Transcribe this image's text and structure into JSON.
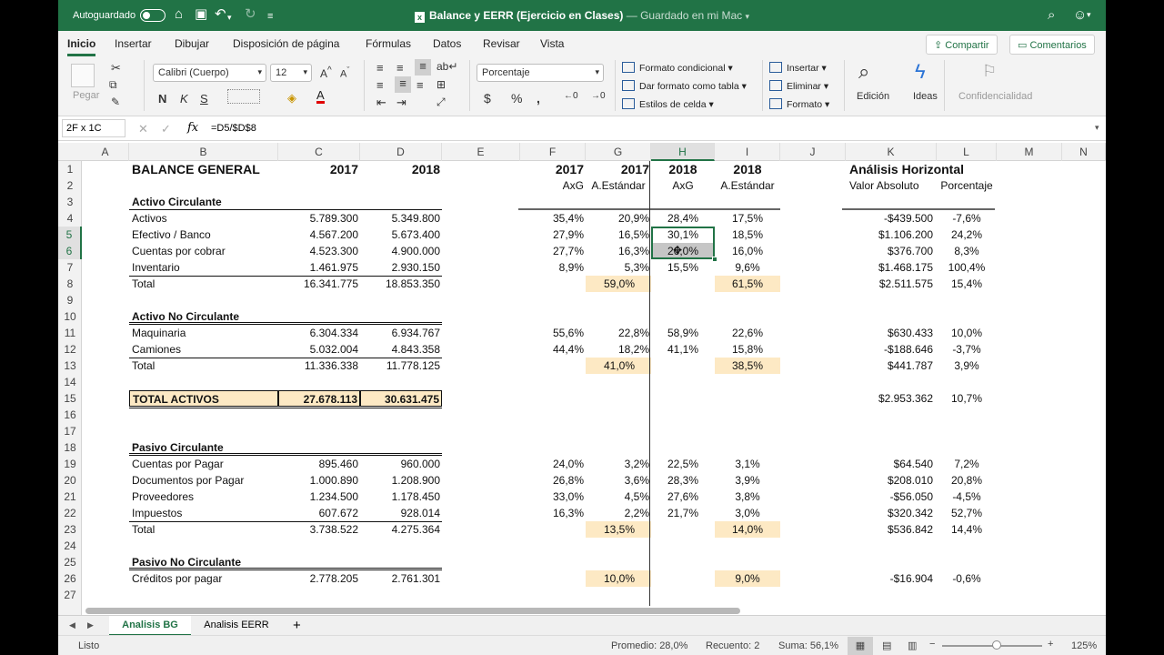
{
  "titlebar": {
    "autosave_label": "Autoguardado",
    "title": "Balance y EERR (Ejercicio en Clases)",
    "subtitle": "— Guardado en mi Mac"
  },
  "ribbon_tabs": [
    "Inicio",
    "Insertar",
    "Dibujar",
    "Disposición de página",
    "Fórmulas",
    "Datos",
    "Revisar",
    "Vista"
  ],
  "share_label": "Compartir",
  "comments_label": "Comentarios",
  "ribbon": {
    "paste_label": "Pegar",
    "font_name": "Calibri (Cuerpo)",
    "font_size": "12",
    "number_format": "Porcentaje",
    "conditional_format": "Formato condicional",
    "format_as_table": "Dar formato como tabla",
    "cell_styles": "Estilos de celda",
    "insert": "Insertar",
    "delete": "Eliminar",
    "format": "Formato",
    "edit": "Edición",
    "ideas": "Ideas",
    "confidentiality": "Confidencialidad"
  },
  "formula_bar": {
    "name_box": "2F x 1C",
    "formula": "=D5/$D$8"
  },
  "columns": [
    "A",
    "B",
    "C",
    "D",
    "E",
    "F",
    "G",
    "H",
    "I",
    "J",
    "K",
    "L",
    "M",
    "N"
  ],
  "rows": [
    "1",
    "2",
    "3",
    "4",
    "5",
    "6",
    "7",
    "8",
    "9",
    "10",
    "11",
    "12",
    "13",
    "14",
    "15",
    "16",
    "17",
    "18",
    "19",
    "20",
    "21",
    "22",
    "23",
    "24",
    "25",
    "26",
    "27"
  ],
  "header": {
    "title": "BALANCE GENERAL",
    "y2017": "2017",
    "y2018": "2018",
    "f1": "2017",
    "g1": "2017",
    "h1": "2018",
    "i1": "2018",
    "f2": "AxG",
    "g2": "A.Estándar",
    "h2": "AxG",
    "i2": "A.Estándar",
    "k1": "Análisis Horizontal",
    "k2": "Valor Absoluto",
    "l2": "Porcentaje"
  },
  "sections": {
    "activo_circulante": "Activo Circulante",
    "activo_no_circulante": "Activo No Circulante",
    "pasivo_circulante": "Pasivo Circulante",
    "pasivo_no_circulante": "Pasivo No Circulante"
  },
  "table_rows": [
    {
      "row": 4,
      "label": "Activos",
      "c": "5.789.300",
      "d": "5.349.800",
      "f": "35,4%",
      "g": "20,9%",
      "h": "28,4%",
      "i": "17,5%",
      "k": "-$439.500",
      "l": "-7,6%"
    },
    {
      "row": 5,
      "label": "Efectivo / Banco",
      "c": "4.567.200",
      "d": "5.673.400",
      "f": "27,9%",
      "g": "16,5%",
      "h": "30,1%",
      "i": "18,5%",
      "k": "$1.106.200",
      "l": "24,2%"
    },
    {
      "row": 6,
      "label": "Cuentas por cobrar",
      "c": "4.523.300",
      "d": "4.900.000",
      "f": "27,7%",
      "g": "16,3%",
      "h": "26,0%",
      "i": "16,0%",
      "k": "$376.700",
      "l": "8,3%"
    },
    {
      "row": 7,
      "label": "Inventario",
      "c": "1.461.975",
      "d": "2.930.150",
      "f": "8,9%",
      "g": "5,3%",
      "h": "15,5%",
      "i": "9,6%",
      "k": "$1.468.175",
      "l": "100,4%"
    },
    {
      "row": 8,
      "label": "Total",
      "c": "16.341.775",
      "d": "18.853.350",
      "f": "",
      "g": "59,0%",
      "h": "",
      "i": "61,5%",
      "k": "$2.511.575",
      "l": "15,4%"
    },
    {
      "row": 11,
      "label": "Maquinaria",
      "c": "6.304.334",
      "d": "6.934.767",
      "f": "55,6%",
      "g": "22,8%",
      "h": "58,9%",
      "i": "22,6%",
      "k": "$630.433",
      "l": "10,0%"
    },
    {
      "row": 12,
      "label": "Camiones",
      "c": "5.032.004",
      "d": "4.843.358",
      "f": "44,4%",
      "g": "18,2%",
      "h": "41,1%",
      "i": "15,8%",
      "k": "-$188.646",
      "l": "-3,7%"
    },
    {
      "row": 13,
      "label": "Total",
      "c": "11.336.338",
      "d": "11.778.125",
      "f": "",
      "g": "41,0%",
      "h": "",
      "i": "38,5%",
      "k": "$441.787",
      "l": "3,9%"
    },
    {
      "row": 15,
      "label": "TOTAL ACTIVOS",
      "c": "27.678.113",
      "d": "30.631.475",
      "f": "",
      "g": "",
      "h": "",
      "i": "",
      "k": "$2.953.362",
      "l": "10,7%"
    },
    {
      "row": 19,
      "label": "Cuentas por Pagar",
      "c": "895.460",
      "d": "960.000",
      "f": "24,0%",
      "g": "3,2%",
      "h": "22,5%",
      "i": "3,1%",
      "k": "$64.540",
      "l": "7,2%"
    },
    {
      "row": 20,
      "label": "Documentos por Pagar",
      "c": "1.000.890",
      "d": "1.208.900",
      "f": "26,8%",
      "g": "3,6%",
      "h": "28,3%",
      "i": "3,9%",
      "k": "$208.010",
      "l": "20,8%"
    },
    {
      "row": 21,
      "label": "Proveedores",
      "c": "1.234.500",
      "d": "1.178.450",
      "f": "33,0%",
      "g": "4,5%",
      "h": "27,6%",
      "i": "3,8%",
      "k": "-$56.050",
      "l": "-4,5%"
    },
    {
      "row": 22,
      "label": "Impuestos",
      "c": "607.672",
      "d": "928.014",
      "f": "16,3%",
      "g": "2,2%",
      "h": "21,7%",
      "i": "3,0%",
      "k": "$320.342",
      "l": "52,7%"
    },
    {
      "row": 23,
      "label": "Total",
      "c": "3.738.522",
      "d": "4.275.364",
      "f": "",
      "g": "13,5%",
      "h": "",
      "i": "14,0%",
      "k": "$536.842",
      "l": "14,4%"
    },
    {
      "row": 26,
      "label": "Créditos por pagar",
      "c": "2.778.205",
      "d": "2.761.301",
      "f": "",
      "g": "10,0%",
      "h": "",
      "i": "9,0%",
      "k": "-$16.904",
      "l": "-0,6%"
    }
  ],
  "sheet_tabs": [
    "Analisis BG",
    "Analisis EERR"
  ],
  "status": {
    "ready": "Listo",
    "average": "Promedio: 28,0%",
    "count": "Recuento: 2",
    "sum": "Suma: 56,1%",
    "zoom": "125%"
  },
  "colors": {
    "excel_green": "#217346",
    "highlight_yellow": "#fde9c4",
    "selected_fill": "#c6c6c6"
  }
}
